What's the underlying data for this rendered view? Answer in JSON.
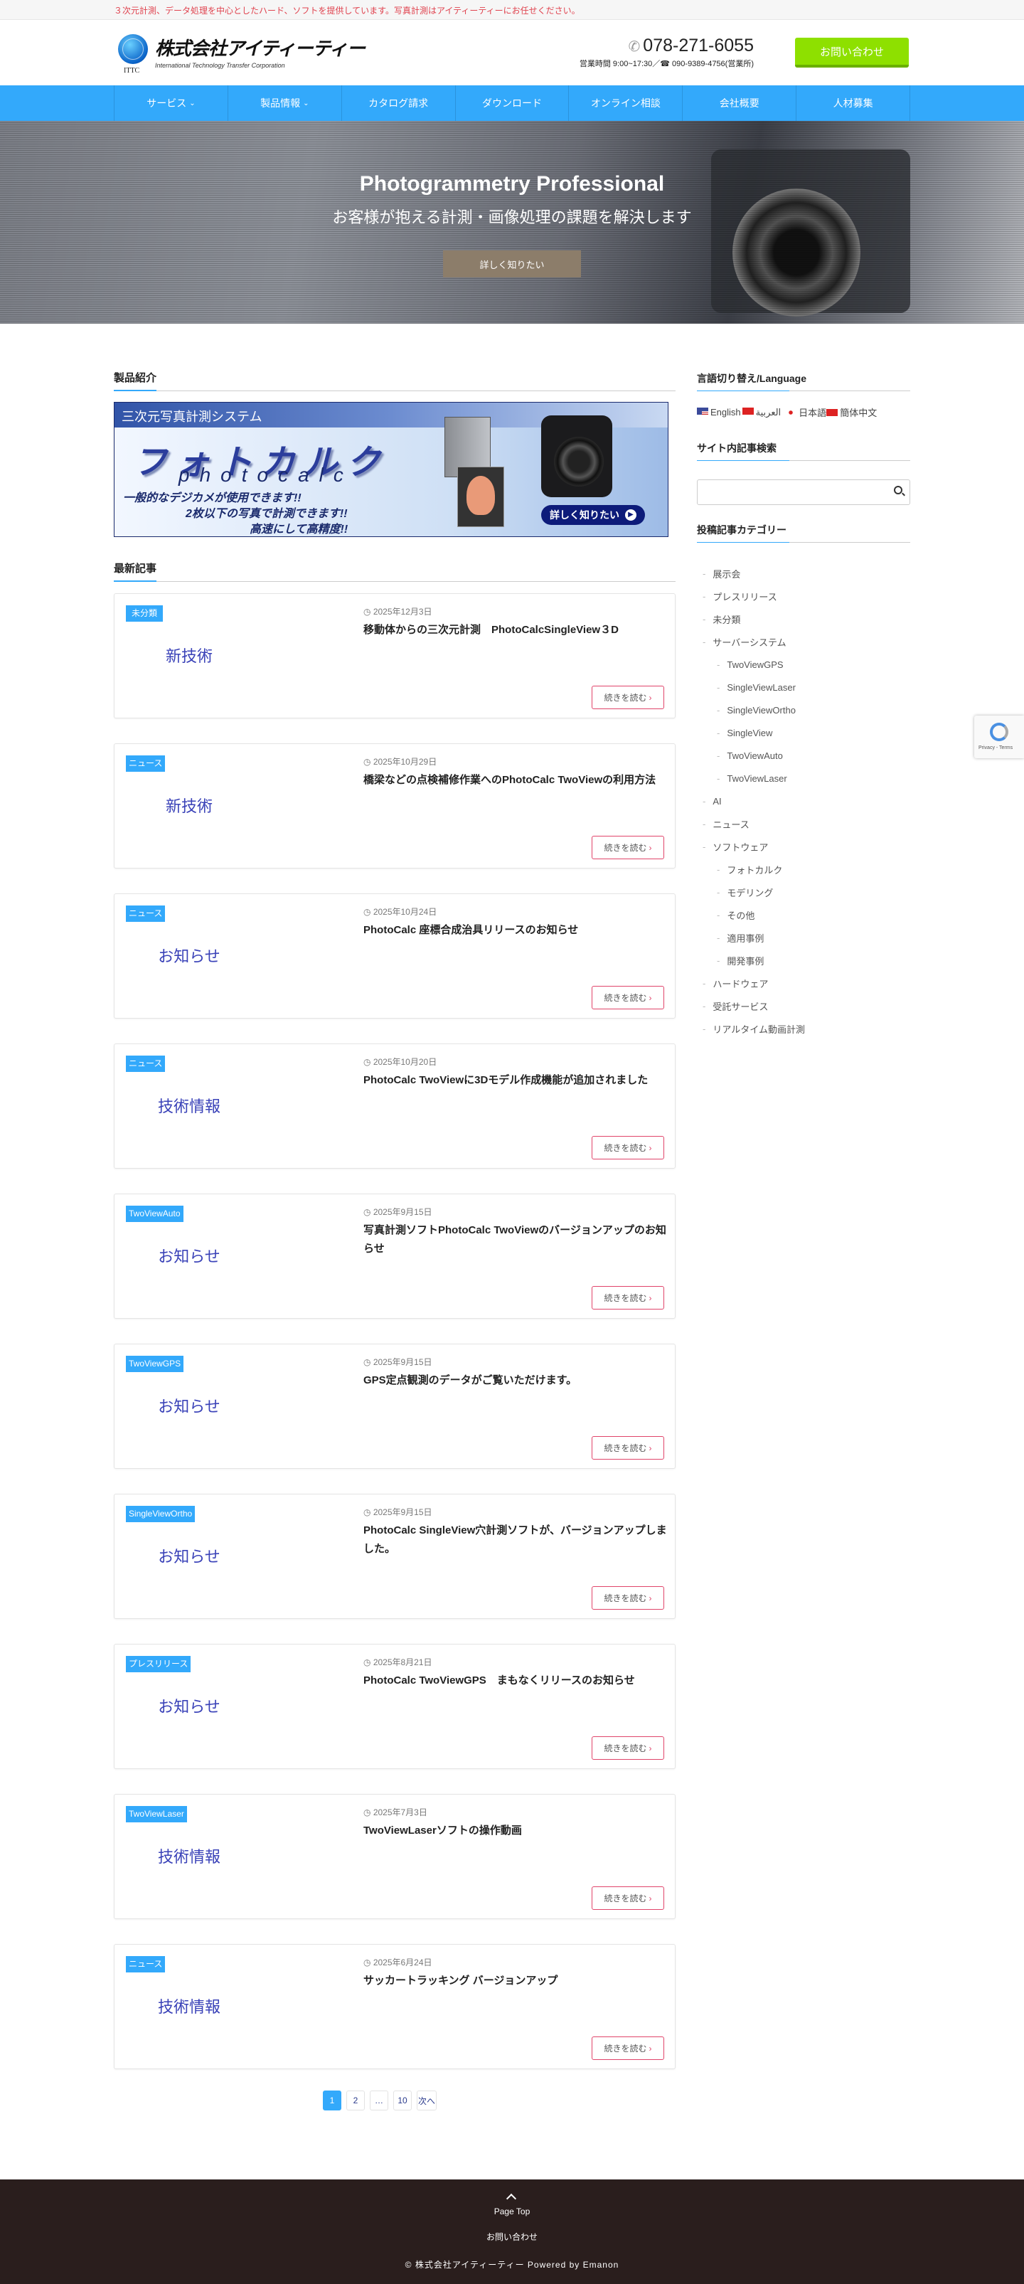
{
  "topbar": {
    "text": "３次元計測、データ処理を中心としたハード、ソフトを提供しています。写真計測はアイティーティーにお任せください。"
  },
  "header": {
    "logo_name": "株式会社アイティーティー",
    "logo_sub": "International Technology Transfer Corporation",
    "logo_mark": "ITTC",
    "phone": "078-271-6055",
    "hours": "営業時間 9:00~17:30／☎ 090-9389-4756(営業所)",
    "contact_label": "お問い合わせ"
  },
  "nav": [
    {
      "label": "サービス",
      "dropdown": true
    },
    {
      "label": "製品情報",
      "dropdown": true
    },
    {
      "label": "カタログ請求"
    },
    {
      "label": "ダウンロード"
    },
    {
      "label": "オンライン相談"
    },
    {
      "label": "会社概要"
    },
    {
      "label": "人材募集"
    }
  ],
  "hero": {
    "title": "Photogrammetry Professional",
    "subtitle": "お客様が抱える計測・画像処理の課題を解決します",
    "button": "詳しく知りたい"
  },
  "products": {
    "section_title": "製品紹介",
    "banner": {
      "header": "三次元写真計測システム",
      "name_kana": "フォトカルク",
      "name_en": "photocalc",
      "line1": "一般的なデジカメが使用できます!!",
      "line2": "2枚以下の写真で計測できます!!",
      "line3": "高速にして高精度!!",
      "button": "詳しく知りたい"
    }
  },
  "latest": {
    "section_title": "最新記事",
    "read_more": "続きを読む",
    "posts": [
      {
        "category": "未分類",
        "date": "2025年12月3日",
        "title": "移動体からの三次元計測　PhotoCalcSingleView３D",
        "thumb": "新技術"
      },
      {
        "category": "ニュース",
        "date": "2025年10月29日",
        "title": "橋梁などの点検補修作業へのPhotoCalc TwoViewの利用方法",
        "thumb": "新技術"
      },
      {
        "category": "ニュース",
        "date": "2025年10月24日",
        "title": "PhotoCalc 座標合成治具リリースのお知らせ",
        "thumb": "お知らせ"
      },
      {
        "category": "ニュース",
        "date": "2025年10月20日",
        "title": "PhotoCalc TwoViewに3Dモデル作成機能が追加されました",
        "thumb": "技術情報"
      },
      {
        "category": "TwoViewAuto",
        "date": "2025年9月15日",
        "title": "写真計測ソフトPhotoCalc TwoViewのバージョンアップのお知らせ",
        "thumb": "お知らせ"
      },
      {
        "category": "TwoViewGPS",
        "date": "2025年9月15日",
        "title": "GPS定点観測のデータがご覧いただけます。",
        "thumb": "お知らせ"
      },
      {
        "category": "SingleViewOrtho",
        "date": "2025年9月15日",
        "title": "PhotoCalc SingleView穴計測ソフトが、バージョンアップしました。",
        "thumb": "お知らせ"
      },
      {
        "category": "プレスリリース",
        "date": "2025年8月21日",
        "title": "PhotoCalc TwoViewGPS　まもなくリリースのお知らせ",
        "thumb": "お知らせ"
      },
      {
        "category": "TwoViewLaser",
        "date": "2025年7月3日",
        "title": "TwoViewLaserソフトの操作動画",
        "thumb": "技術情報"
      },
      {
        "category": "ニュース",
        "date": "2025年6月24日",
        "title": "サッカートラッキング バージョンアップ",
        "thumb": "技術情報"
      }
    ]
  },
  "pagination": {
    "pages": [
      "1",
      "2",
      "…",
      "10"
    ],
    "current": "1",
    "next": "次へ"
  },
  "sidebar": {
    "language_title": "言語切り替え/Language",
    "languages": [
      "English",
      "العربية",
      "日本語",
      "簡体中文"
    ],
    "search_title": "サイト内記事検索",
    "search_value": "",
    "category_title": "投稿記事カテゴリー",
    "categories": [
      {
        "label": "展示会",
        "level": 0
      },
      {
        "label": "プレスリリース",
        "level": 0
      },
      {
        "label": "未分類",
        "level": 0
      },
      {
        "label": "サーバーシステム",
        "level": 0
      },
      {
        "label": "TwoViewGPS",
        "level": 1
      },
      {
        "label": "SingleViewLaser",
        "level": 1
      },
      {
        "label": "SingleViewOrtho",
        "level": 1
      },
      {
        "label": "SingleView",
        "level": 1
      },
      {
        "label": "TwoViewAuto",
        "level": 1
      },
      {
        "label": "TwoViewLaser",
        "level": 1
      },
      {
        "label": "AI",
        "level": 0
      },
      {
        "label": "ニュース",
        "level": 0
      },
      {
        "label": "ソフトウェア",
        "level": 0
      },
      {
        "label": "フォトカルク",
        "level": 1
      },
      {
        "label": "モデリング",
        "level": 1
      },
      {
        "label": "その他",
        "level": 1
      },
      {
        "label": "適用事例",
        "level": 1
      },
      {
        "label": "開発事例",
        "level": 1
      },
      {
        "label": "ハードウェア",
        "level": 0
      },
      {
        "label": "受託サービス",
        "level": 0
      },
      {
        "label": "リアルタイム動画計測",
        "level": 0
      }
    ]
  },
  "recaptcha": {
    "text": "Privacy - Terms"
  },
  "footer": {
    "page_top": "Page Top",
    "contact": "お問い合わせ",
    "copyright": "© 株式会社アイティーティー Powered by Emanon"
  },
  "colors": {
    "accent": "#33a9fb",
    "cta": "#8ee000",
    "footer": "#2a1e1d",
    "thumb_text": "#3a42b8",
    "read_more_border": "#e0446a"
  }
}
